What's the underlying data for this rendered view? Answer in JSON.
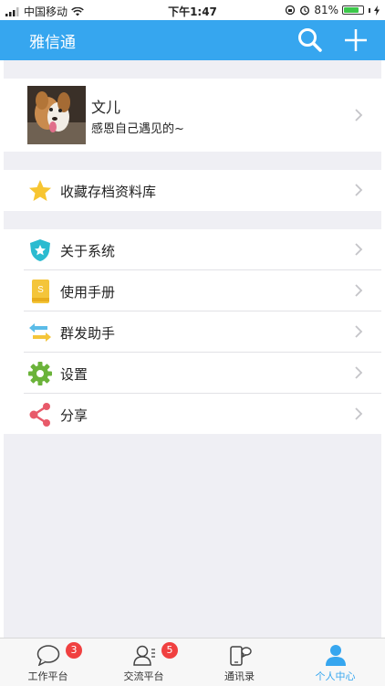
{
  "status_bar": {
    "carrier": "中国移动",
    "time": "下午1:47",
    "battery": "81%",
    "battery_level": 0.81,
    "icons": [
      "signal-icon",
      "wifi-icon",
      "orientation-lock-icon",
      "alarm-icon",
      "battery-icon",
      "charging-icon"
    ]
  },
  "header": {
    "title": "雅信通",
    "icons": [
      "search-icon",
      "add-icon"
    ]
  },
  "profile": {
    "name": "文儿",
    "signature": "感恩自己遇见的~"
  },
  "menu": {
    "favorites": {
      "label": "收藏存档资料库",
      "icon": "star-icon",
      "color": "#f7c531"
    },
    "items": [
      {
        "label": "关于系统",
        "icon": "shield-icon",
        "color": "#2bbbd0"
      },
      {
        "label": "使用手册",
        "icon": "manual-book-icon",
        "color": "#f4c53a"
      },
      {
        "label": "群发助手",
        "icon": "broadcast-arrows-icon",
        "color": "#5bbce8"
      },
      {
        "label": "设置",
        "icon": "gear-icon",
        "color": "#6bb33a"
      },
      {
        "label": "分享",
        "icon": "share-icon",
        "color": "#e85a6a"
      }
    ]
  },
  "tabbar": {
    "tabs": [
      {
        "label": "工作平台",
        "icon": "chat-bubble-icon",
        "badge": "3",
        "active": false
      },
      {
        "label": "交流平台",
        "icon": "contacts-icon",
        "badge": "5",
        "active": false
      },
      {
        "label": "通讯录",
        "icon": "phone-chat-icon",
        "badge": "",
        "active": false
      },
      {
        "label": "个人中心",
        "icon": "person-icon",
        "badge": "",
        "active": true
      }
    ],
    "active_color": "#36a6ef"
  }
}
